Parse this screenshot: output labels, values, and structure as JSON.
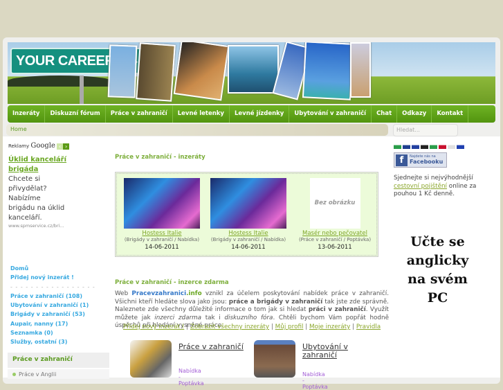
{
  "banner": {
    "sign_text": "YOUR CAREER",
    "arrow": "➔"
  },
  "nav": [
    "Inzeráty",
    "Diskuzní fórum",
    "Práce v zahraničí",
    "Levné letenky",
    "Levné jízdenky",
    "Ubytování v zahraničí",
    "Chat",
    "Odkazy",
    "Kontakt"
  ],
  "breadcrumb": "Home",
  "search": {
    "placeholder": "Hledat..."
  },
  "ads": {
    "label": "Reklamy",
    "brand": "Google",
    "title1": "Úklid kanceláří",
    "title2": "brigáda",
    "text": "Chcete si přivydělat? Nabízíme brigádu na úklid kanceláří.",
    "url": "www.spmservice.cz/bri..."
  },
  "categories": {
    "home": "Domů",
    "add": "Přidej nový inzerát !",
    "divider": "- - - - - - - - - - - - - - - - -",
    "items": [
      "Práce v zahraničí (108)",
      "Ubytování v zahraničí (1)",
      "Brigády v zahraničí (53)",
      "Aupair, nanny (17)",
      "Seznamka (0)",
      "Služby, ostatní (3)"
    ]
  },
  "side_box": {
    "title": "Práce v zahraničí",
    "item": "Práce v Anglii"
  },
  "listing": {
    "heading": "Práce v zahraničí - inzeráty",
    "no_image": "Bez obrázku",
    "items": [
      {
        "title": "Hostess Italie",
        "category": "(Brigády v zahraničí / Nabídka)",
        "date": "14-06-2011"
      },
      {
        "title": "Hostess Italie",
        "category": "(Brigády v zahraničí / Nabídka)",
        "date": "14-06-2011"
      },
      {
        "title": "Masér nebo pečovatel",
        "category": "(Práce v zahraničí / Poptávka)",
        "date": "13-06-2011"
      }
    ]
  },
  "intro": {
    "heading": "Práce v zahraničí - inzerce zdarma",
    "p1": "Web ",
    "site1": "Pracevzahranici",
    "site2": ".info",
    "p2": " vznikl za účelem poskytování nabídek práce v zahraničí. Všichni kteří hledáte slova jako jsou: ",
    "b1": "práce a brigády v zahraničí",
    "p3": " tak jste zde správně. Naleznete zde všechny důležité informace o tom jak si hledat ",
    "b2": "práci v zahraničí",
    "p4": ". Využít můžete jak ",
    "i1": "inzerci zdarma",
    "p5": " tak i ",
    "i2": "diskuzního fóra",
    "p6": ". Chtěli bychom Vám popřát hodně úspěchů při hledání vysněné práce."
  },
  "links": [
    "Přidej nový inzerát !",
    "Zobrazit všechny inzeráty",
    "Můj profil",
    "Moje inzeráty",
    "Pravidla"
  ],
  "cards": [
    {
      "title": "Práce v zahraničí",
      "sub": "Nabídka - Poptávka"
    },
    {
      "title": "Ubytování v zahraničí",
      "sub": "Nabídka - Poptávka"
    }
  ],
  "right": {
    "fb_small": "Najdete nás na",
    "fb_big": "Facebooku",
    "ins1": "Sjednejte si nejvýhodnější ",
    "ins_link": "cestovní pojištění",
    "ins2": " online za pouhou 1 Kč denně.",
    "eng_ad": "Učte se anglicky na svém PC",
    "flags": [
      "#2a9d4a",
      "#1f3f8f",
      "#2340a0",
      "#222",
      "#2a9d4a",
      "#c8102e",
      "#e0e0e0",
      "#2040b0"
    ]
  }
}
